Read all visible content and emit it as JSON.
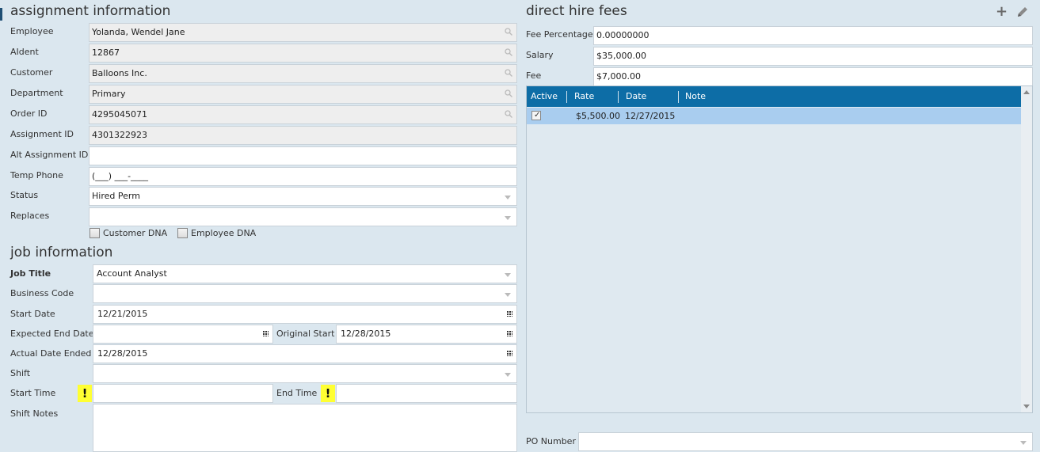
{
  "assignment": {
    "title": "assignment information",
    "employee": {
      "label": "Employee",
      "value": "Yolanda, Wendel Jane"
    },
    "aident": {
      "label": "AIdent",
      "value": "12867"
    },
    "customer": {
      "label": "Customer",
      "value": "Balloons Inc."
    },
    "department": {
      "label": "Department",
      "value": "Primary"
    },
    "order_id": {
      "label": "Order ID",
      "value": "4295045071"
    },
    "assignment_id": {
      "label": "Assignment ID",
      "value": "4301322923"
    },
    "alt_assignment_id": {
      "label": "Alt Assignment ID",
      "value": ""
    },
    "temp_phone": {
      "label": "Temp Phone",
      "value": "(___) ___-____"
    },
    "status": {
      "label": "Status",
      "value": "Hired Perm"
    },
    "replaces": {
      "label": "Replaces",
      "value": ""
    },
    "customer_dna": {
      "label": "Customer DNA",
      "checked": false
    },
    "employee_dna": {
      "label": "Employee DNA",
      "checked": false
    }
  },
  "job": {
    "title": "job information",
    "job_title": {
      "label": "Job Title",
      "value": "Account Analyst"
    },
    "business_code": {
      "label": "Business Code",
      "value": ""
    },
    "start_date": {
      "label": "Start Date",
      "value": "12/21/2015"
    },
    "expected_end_date": {
      "label": "Expected End Date",
      "value": ""
    },
    "original_start": {
      "label": "Original Start",
      "value": "12/28/2015"
    },
    "actual_date_ended": {
      "label": "Actual Date Ended",
      "value": "12/28/2015"
    },
    "shift": {
      "label": "Shift",
      "value": ""
    },
    "start_time": {
      "label": "Start Time",
      "value": "",
      "warning": "!"
    },
    "end_time": {
      "label": "End Time",
      "value": "",
      "warning": "!"
    },
    "shift_notes": {
      "label": "Shift Notes",
      "value": ""
    }
  },
  "direct_hire": {
    "title": "direct hire fees",
    "fee_percentage": {
      "label": "Fee Percentage",
      "value": "0.00000000"
    },
    "salary": {
      "label": "Salary",
      "value": "$35,000.00"
    },
    "fee": {
      "label": "Fee",
      "value": "$7,000.00"
    },
    "grid": {
      "columns": [
        "Active",
        "Rate",
        "Date",
        "Note"
      ],
      "rows": [
        {
          "active": true,
          "rate": "$5,500.00",
          "date": "12/27/2015",
          "note": ""
        }
      ]
    },
    "po_number": {
      "label": "PO Number",
      "value": ""
    }
  },
  "icons": {
    "add": "plus-icon",
    "edit": "pencil-icon",
    "lookup": "search-icon",
    "calendar": "calendar-icon",
    "dropdown": "chevron-down-icon"
  },
  "colors": {
    "grid_header": "#0d6da6",
    "selected_row": "#a9cdef",
    "warning": "#ffff33"
  }
}
